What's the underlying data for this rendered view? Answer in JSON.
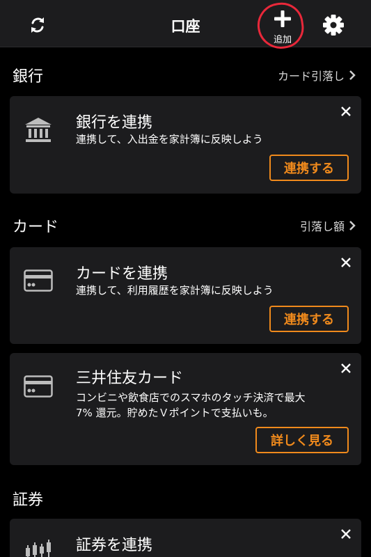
{
  "header": {
    "title": "口座",
    "add_label": "追加",
    "sync_icon": "sync-icon",
    "add_icon": "plus-icon",
    "settings_icon": "gear-icon"
  },
  "sections": {
    "bank": {
      "title": "銀行",
      "link": "カード引落し",
      "card": {
        "title": "銀行を連携",
        "desc": "連携して、入出金を家計簿に反映しよう",
        "cta": "連携する",
        "icon": "bank-icon"
      }
    },
    "cards": {
      "title": "カード",
      "link": "引落し額",
      "link_card": {
        "title": "カードを連携",
        "desc": "連携して、利用履歴を家計簿に反映しよう",
        "cta": "連携する",
        "icon": "credit-card-icon"
      },
      "promo_card": {
        "title": "三井住友カード",
        "desc_line1": "コンビニや飲食店でのスマホのタッチ決済で最大",
        "desc_line2": "7% 還元。貯めたＶポイントで支払いも。",
        "cta": "詳しく見る",
        "icon": "credit-card-icon"
      }
    },
    "securities": {
      "title": "証券",
      "card": {
        "title": "証券を連携",
        "icon": "candlestick-chart-icon"
      }
    }
  },
  "colors": {
    "background": "#000000",
    "surface": "#1c1c1e",
    "accent": "#f08a1c",
    "highlight": "#e8283a"
  }
}
